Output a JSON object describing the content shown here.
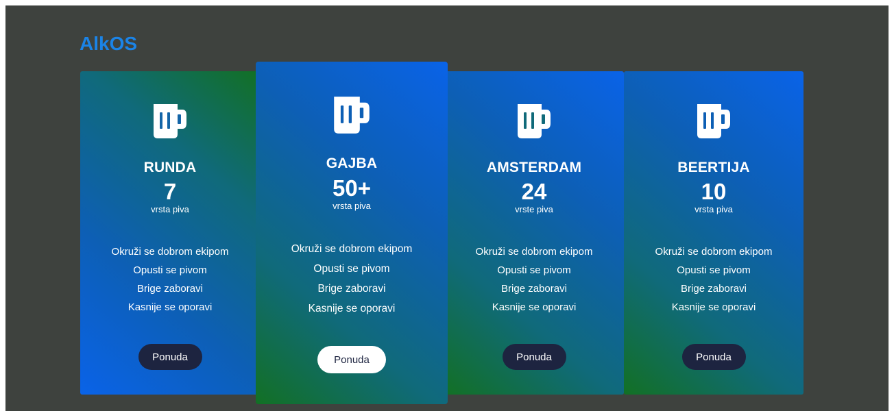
{
  "brand": {
    "title": "AlkOS",
    "color": "#1b84e7"
  },
  "cards": [
    {
      "title": "RUNDA",
      "count": "7",
      "unit": "vrsta piva",
      "icon": "beer-mug-icon",
      "features": [
        "Okruži se dobrom ekipom",
        "Opusti se pivom",
        "Brige zaboravi",
        "Kasnije se oporavi"
      ],
      "button_label": "Ponuda"
    },
    {
      "title": "GAJBA",
      "count": "50+",
      "unit": "vrsta piva",
      "icon": "beer-mug-icon",
      "features": [
        "Okruži se dobrom ekipom",
        "Opusti se pivom",
        "Brige zaboravi",
        "Kasnije se oporavi"
      ],
      "button_label": "Ponuda"
    },
    {
      "title": "AMSTERDAM",
      "count": "24",
      "unit": "vrste piva",
      "icon": "beer-mug-icon",
      "features": [
        "Okruži se dobrom ekipom",
        "Opusti se pivom",
        "Brige zaboravi",
        "Kasnije se oporavi"
      ],
      "button_label": "Ponuda"
    },
    {
      "title": "BEERTIJA",
      "count": "10",
      "unit": "vrsta piva",
      "icon": "beer-mug-icon",
      "features": [
        "Okruži se dobrom ekipom",
        "Opusti se pivom",
        "Brige zaboravi",
        "Kasnije se oporavi"
      ],
      "button_label": "Ponuda"
    }
  ],
  "colors": {
    "background": "#3e423e",
    "gradient_blue": "#0a63e8",
    "gradient_green": "#127024",
    "button_dark": "#1d2440",
    "button_light": "#ffffff"
  }
}
